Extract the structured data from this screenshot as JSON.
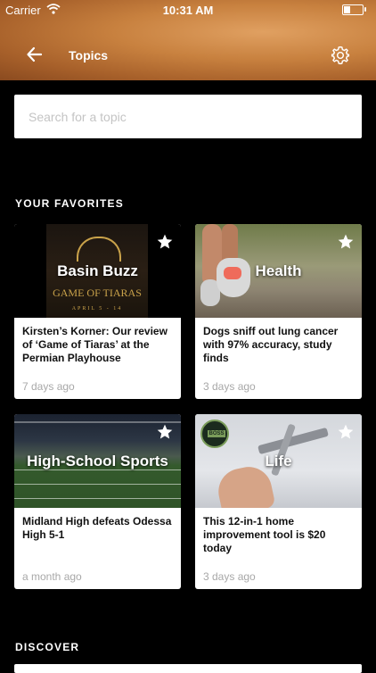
{
  "status_bar": {
    "carrier": "Carrier",
    "time": "10:31 AM"
  },
  "header": {
    "title": "Topics"
  },
  "search": {
    "placeholder": "Search for a topic"
  },
  "sections": {
    "favorites": "YOUR FAVORITES",
    "discover": "DISCOVER"
  },
  "cards": [
    {
      "topic": "Basin Buzz",
      "headline": "Kirsten’s Korner: Our review of ‘Game of Tiaras’ at the Permian Playhouse",
      "age": "7 days ago",
      "image_text": {
        "main": "GAME OF TIARAS",
        "sub": "APRIL 5 - 14"
      }
    },
    {
      "topic": "Health",
      "headline": "Dogs sniff out lung cancer with 97% accuracy, study finds",
      "age": "3 days ago"
    },
    {
      "topic": "High-School Sports",
      "headline": "Midland High defeats Odessa High 5-1",
      "age": "a month ago"
    },
    {
      "topic": "Life",
      "headline": "This 12-in-1 home improvement tool is $20 today",
      "age": "3 days ago",
      "image_text": {
        "badge": "BOSS"
      }
    }
  ],
  "icons": {
    "back": "arrow-left-icon",
    "settings": "gear-icon",
    "favorite": "star-icon",
    "wifi": "wifi-icon",
    "battery": "battery-icon"
  },
  "colors": {
    "header_accent": "#c8813f",
    "background": "#000000",
    "card": "#ffffff",
    "age_text": "#a8a8a8"
  }
}
